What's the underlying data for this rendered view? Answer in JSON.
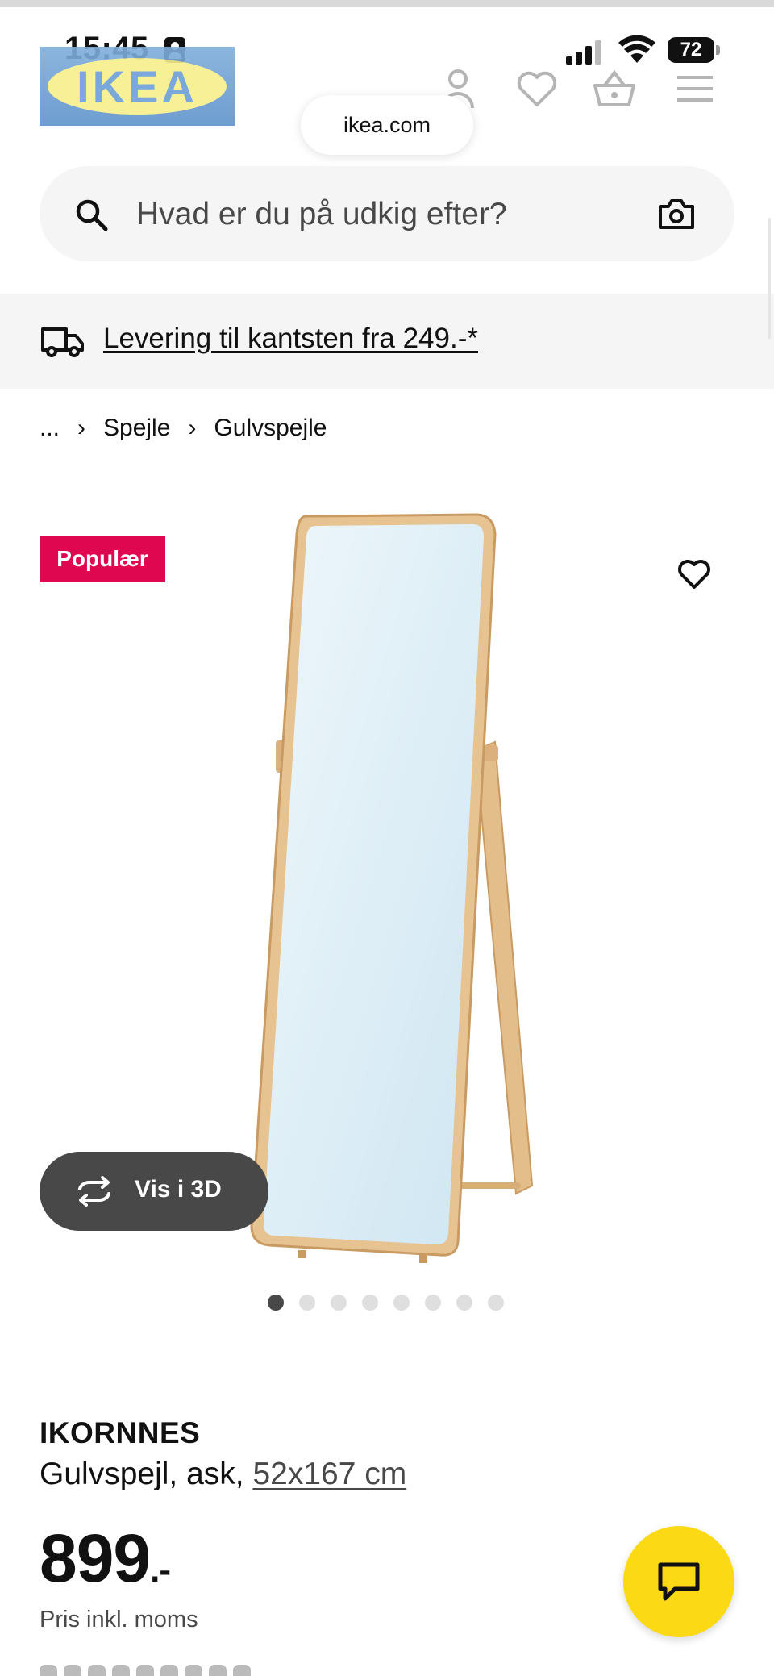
{
  "status_bar": {
    "time": "15:45",
    "battery": "72"
  },
  "header": {
    "logo_text": "IKEA",
    "url": "ikea.com",
    "icons": [
      "account-icon",
      "heart-icon",
      "basket-icon",
      "menu-icon"
    ]
  },
  "search": {
    "placeholder": "Hvad er du på udkig efter?"
  },
  "delivery": {
    "text": "Levering til kantsten fra 249.-*"
  },
  "breadcrumb": {
    "ellipsis": "...",
    "items": [
      "Spejle",
      "Gulvspejle"
    ]
  },
  "product": {
    "badge": "Populær",
    "view_3d": "Vis i 3D",
    "image_count": 8,
    "active_image": 1,
    "name": "IKORNNES",
    "description": "Gulvspejl, ask, ",
    "dimensions": "52x167 cm",
    "price": "899",
    "price_suffix": ".-",
    "price_note": "Pris inkl. moms"
  },
  "colors": {
    "badge": "#e00751",
    "chat": "#fbd914",
    "view3d_bg": "#484848"
  }
}
